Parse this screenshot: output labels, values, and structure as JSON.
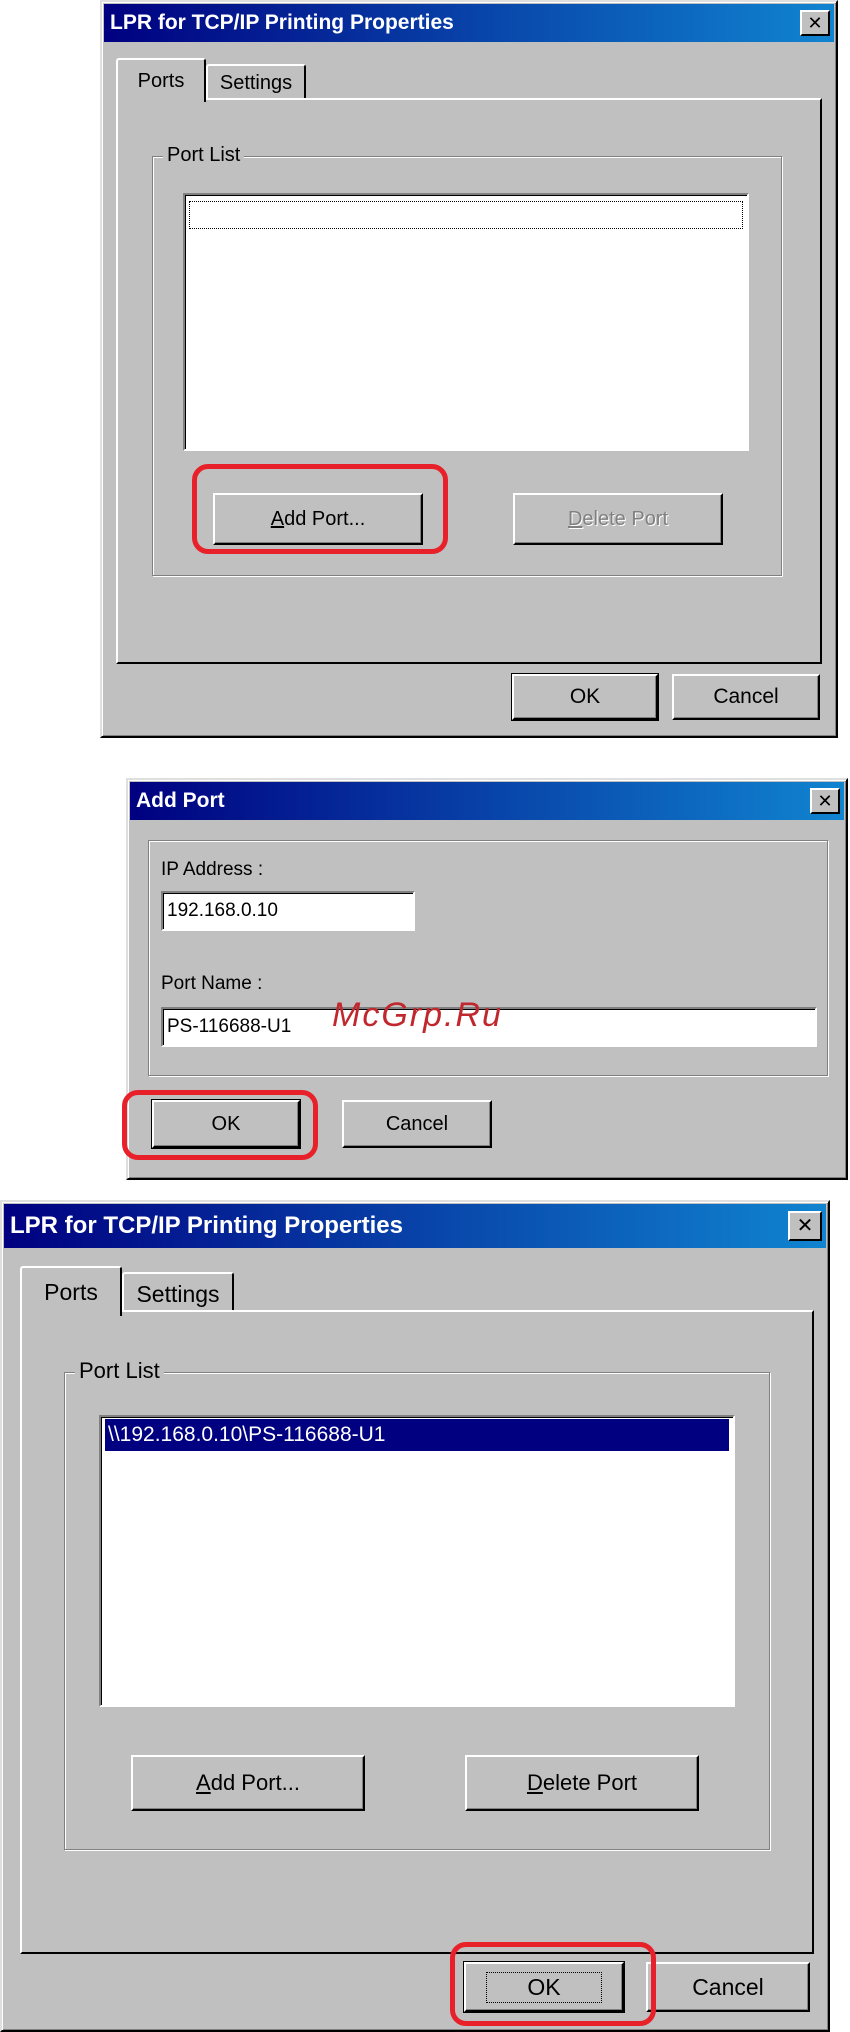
{
  "dialog1": {
    "title": "LPR for TCP/IP Printing Properties",
    "close_glyph": "✕",
    "tabs": [
      "Ports",
      "Settings"
    ],
    "group_label": "Port List",
    "list_items": [
      ""
    ],
    "add_port": {
      "prefix": "",
      "accel": "A",
      "rest": "dd Port..."
    },
    "delete_port": {
      "prefix": "",
      "accel": "D",
      "rest": "elete Port"
    },
    "ok_label": "OK",
    "cancel_label": "Cancel"
  },
  "dialog2": {
    "title": "Add Port",
    "close_glyph": "✕",
    "ip_label": "IP Address :",
    "ip_value": "192.168.0.10",
    "port_name_label": "Port Name :",
    "port_name_value": "PS-116688-U1",
    "ok_label": "OK",
    "cancel_label": "Cancel"
  },
  "dialog3": {
    "title": "LPR for TCP/IP Printing Properties",
    "close_glyph": "✕",
    "tabs": [
      "Ports",
      "Settings"
    ],
    "group_label": "Port List",
    "list_items": [
      "\\\\192.168.0.10\\PS-116688-U1"
    ],
    "add_port": {
      "prefix": "",
      "accel": "A",
      "rest": "dd Port..."
    },
    "delete_port": {
      "prefix": "",
      "accel": "D",
      "rest": "elete Port"
    },
    "ok_label": "OK",
    "cancel_label": "Cancel"
  },
  "watermark": "McGrp.Ru",
  "colors": {
    "titlebar": "#000080",
    "highlight": "#e8202a",
    "selection": "#000080",
    "face": "#c0c0c0"
  }
}
